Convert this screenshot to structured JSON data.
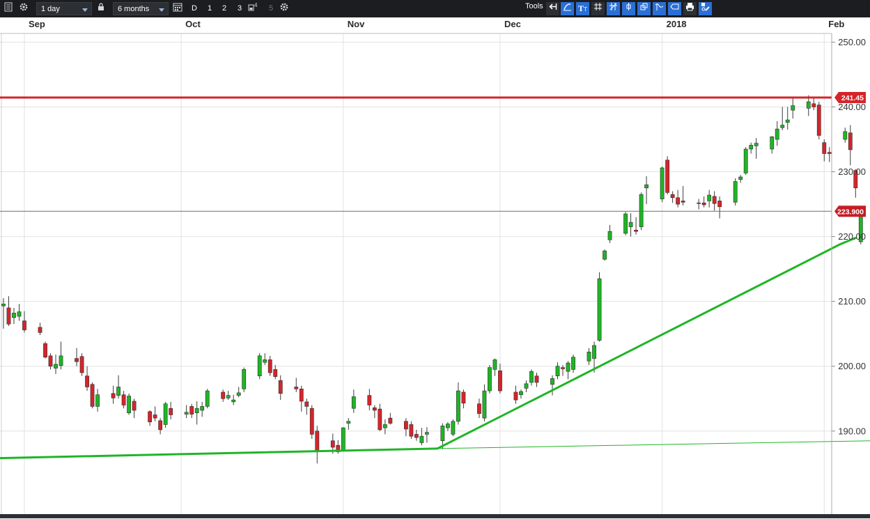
{
  "toolbar": {
    "interval": "1 day",
    "range": "6 months",
    "d_label": "D",
    "btn1": "1",
    "btn2": "2",
    "btn3": "3",
    "btn4_sup": "4",
    "btn5": "5",
    "tools_label": "Tools"
  },
  "colors": {
    "up": "#1fb526",
    "down": "#d4252b",
    "resistance": "#d4252b",
    "trend": "#1fb526",
    "grid": "#e2e2e2",
    "toolbar": "#1b1d20"
  },
  "chart_data": {
    "type": "candlestick",
    "title": "",
    "xlabel": "",
    "ylabel": "",
    "x_ticks": [
      {
        "label": "Sep",
        "day": 0
      },
      {
        "label": "Oct",
        "day": 30
      },
      {
        "label": "Nov",
        "day": 61
      },
      {
        "label": "Dec",
        "day": 91
      },
      {
        "label": "2018",
        "day": 122
      },
      {
        "label": "Feb",
        "day": 153
      }
    ],
    "y_ticks": [
      190,
      200,
      210,
      220,
      230,
      240,
      250
    ],
    "y_tick_labels": [
      "190.00",
      "200.00",
      "210.00",
      "220.00",
      "230.00",
      "240.00",
      "250.00"
    ],
    "ylim": [
      178,
      253
    ],
    "grid": true,
    "resistance": {
      "value": 241.45,
      "label": "241.45"
    },
    "last_price": {
      "value": 223.9,
      "label": "223.900"
    },
    "trendlines": [
      {
        "id": "lower-trendline",
        "points": [
          [
            "2017-08-26",
            185.8
          ],
          [
            "2017-11-19",
            187.3
          ]
        ],
        "width": 3
      },
      {
        "id": "upper-trendline",
        "points": [
          [
            "2017-11-19",
            187.3
          ],
          [
            "2018-02-04",
            218.8
          ],
          [
            "2018-02-07",
            219.8
          ]
        ],
        "width": 3
      },
      {
        "id": "extension-line",
        "points": [
          [
            "2017-11-19",
            187.3
          ],
          [
            "2018-02-10",
            188.5
          ]
        ],
        "width": 1
      }
    ],
    "ohlc": [
      [
        "2017-08-28",
        209.3,
        210.5,
        205.8,
        209.6
      ],
      [
        "2017-08-29",
        209.0,
        210.8,
        206.2,
        206.5
      ],
      [
        "2017-08-30",
        207.5,
        209.0,
        206.5,
        208.2
      ],
      [
        "2017-08-31",
        207.7,
        209.6,
        207.0,
        208.4
      ],
      [
        "2017-09-01",
        207.0,
        208.5,
        205.2,
        205.6
      ],
      [
        "2017-09-04",
        206.0,
        206.7,
        204.8,
        205.2
      ],
      [
        "2017-09-05",
        203.5,
        203.8,
        201.2,
        201.4
      ],
      [
        "2017-09-06",
        201.6,
        202.0,
        199.5,
        200.0
      ],
      [
        "2017-09-07",
        199.7,
        201.8,
        198.8,
        200.3
      ],
      [
        "2017-09-08",
        200.1,
        203.8,
        199.5,
        201.6
      ],
      [
        "2017-09-11",
        201.2,
        202.8,
        200.0,
        200.7
      ],
      [
        "2017-09-12",
        201.5,
        202.0,
        198.5,
        199.0
      ],
      [
        "2017-09-13",
        198.5,
        200.0,
        196.2,
        196.8
      ],
      [
        "2017-09-14",
        197.2,
        197.5,
        193.5,
        193.8
      ],
      [
        "2017-09-15",
        193.8,
        196.5,
        193.0,
        195.6
      ],
      [
        "2017-09-18",
        195.8,
        197.0,
        194.2,
        195.1
      ],
      [
        "2017-09-19",
        195.5,
        198.6,
        195.0,
        196.8
      ],
      [
        "2017-09-20",
        195.6,
        196.2,
        193.5,
        194.0
      ],
      [
        "2017-09-21",
        192.8,
        195.8,
        192.5,
        195.4
      ],
      [
        "2017-09-22",
        194.6,
        195.0,
        192.0,
        193.2
      ],
      [
        "2017-09-25",
        193.0,
        193.2,
        190.8,
        191.4
      ],
      [
        "2017-09-26",
        192.5,
        193.8,
        191.5,
        192.0
      ],
      [
        "2017-09-27",
        191.6,
        192.0,
        189.5,
        190.2
      ],
      [
        "2017-09-28",
        191.0,
        194.5,
        190.5,
        194.2
      ],
      [
        "2017-09-29",
        193.5,
        194.5,
        191.8,
        192.5
      ],
      [
        "2017-10-02",
        192.6,
        194.0,
        192.0,
        192.9
      ],
      [
        "2017-10-03",
        193.8,
        194.2,
        192.0,
        192.6
      ],
      [
        "2017-10-04",
        192.8,
        194.6,
        191.0,
        193.5
      ],
      [
        "2017-10-05",
        193.2,
        194.5,
        192.2,
        193.8
      ],
      [
        "2017-10-06",
        193.8,
        196.5,
        193.5,
        196.2
      ],
      [
        "2017-10-09",
        196.0,
        196.4,
        194.5,
        195.0
      ],
      [
        "2017-10-10",
        195.1,
        196.2,
        194.8,
        195.5
      ],
      [
        "2017-10-11",
        194.5,
        195.6,
        194.0,
        194.8
      ],
      [
        "2017-10-12",
        195.5,
        196.8,
        195.2,
        195.9
      ],
      [
        "2017-10-13",
        196.5,
        199.8,
        196.0,
        199.5
      ],
      [
        "2017-10-16",
        198.5,
        202.0,
        198.0,
        201.6
      ],
      [
        "2017-10-17",
        200.6,
        202.0,
        200.2,
        201.0
      ],
      [
        "2017-10-18",
        201.0,
        201.6,
        198.5,
        199.0
      ],
      [
        "2017-10-19",
        199.5,
        200.2,
        198.0,
        198.4
      ],
      [
        "2017-10-20",
        197.8,
        198.6,
        194.8,
        195.8
      ],
      [
        "2017-10-23",
        196.8,
        198.2,
        196.0,
        196.5
      ],
      [
        "2017-10-24",
        196.5,
        197.0,
        193.0,
        194.6
      ],
      [
        "2017-10-25",
        194.5,
        195.0,
        192.5,
        193.8
      ],
      [
        "2017-10-26",
        193.5,
        194.0,
        188.8,
        189.5
      ],
      [
        "2017-10-27",
        190.0,
        190.8,
        185.0,
        186.8
      ],
      [
        "2017-10-30",
        188.5,
        189.6,
        186.5,
        187.5
      ],
      [
        "2017-10-31",
        187.8,
        188.6,
        186.5,
        186.8
      ],
      [
        "2017-11-01",
        187.0,
        190.6,
        186.8,
        190.5
      ],
      [
        "2017-11-02",
        191.2,
        192.0,
        190.2,
        191.5
      ],
      [
        "2017-11-03",
        193.5,
        196.4,
        192.8,
        195.3
      ],
      [
        "2017-11-06",
        195.5,
        196.5,
        193.2,
        194.0
      ],
      [
        "2017-11-07",
        193.6,
        194.0,
        192.0,
        193.2
      ],
      [
        "2017-11-08",
        193.4,
        194.2,
        190.0,
        190.2
      ],
      [
        "2017-11-09",
        190.5,
        191.8,
        189.5,
        191.0
      ],
      [
        "2017-11-10",
        192.0,
        192.8,
        191.0,
        191.2
      ],
      [
        "2017-11-13",
        191.5,
        192.0,
        189.2,
        190.3
      ],
      [
        "2017-11-14",
        191.0,
        191.5,
        188.8,
        189.2
      ],
      [
        "2017-11-15",
        189.5,
        190.2,
        188.5,
        189.0
      ],
      [
        "2017-11-16",
        188.2,
        190.5,
        187.8,
        189.2
      ],
      [
        "2017-11-17",
        189.5,
        190.6,
        188.2,
        189.8
      ],
      [
        "2017-11-20",
        188.5,
        191.2,
        187.2,
        190.8
      ],
      [
        "2017-11-21",
        190.5,
        191.4,
        190.0,
        191.1
      ],
      [
        "2017-11-22",
        189.5,
        191.8,
        189.2,
        191.5
      ],
      [
        "2017-11-23",
        191.5,
        197.5,
        191.0,
        196.2
      ],
      [
        "2017-11-24",
        196.0,
        196.4,
        193.5,
        194.3
      ],
      [
        "2017-11-27",
        194.2,
        195.0,
        192.0,
        192.7
      ],
      [
        "2017-11-28",
        192.0,
        197.2,
        191.5,
        196.2
      ],
      [
        "2017-11-29",
        196.2,
        200.2,
        195.8,
        199.8
      ],
      [
        "2017-11-30",
        199.5,
        201.2,
        198.5,
        201.0
      ],
      [
        "2017-12-01",
        199.3,
        200.4,
        195.8,
        196.2
      ],
      [
        "2017-12-04",
        196.0,
        197.0,
        194.2,
        194.8
      ],
      [
        "2017-12-05",
        195.6,
        196.4,
        195.0,
        196.1
      ],
      [
        "2017-12-06",
        196.6,
        197.8,
        196.0,
        197.3
      ],
      [
        "2017-12-07",
        197.5,
        199.5,
        197.0,
        199.2
      ],
      [
        "2017-12-08",
        198.5,
        199.0,
        196.8,
        197.5
      ],
      [
        "2017-12-11",
        197.2,
        198.6,
        195.5,
        198.1
      ],
      [
        "2017-12-12",
        198.5,
        200.6,
        198.0,
        200.0
      ],
      [
        "2017-12-13",
        199.8,
        200.2,
        198.5,
        199.6
      ],
      [
        "2017-12-14",
        199.2,
        200.8,
        198.0,
        200.5
      ],
      [
        "2017-12-15",
        199.5,
        201.8,
        199.0,
        201.4
      ],
      [
        "2017-12-18",
        200.8,
        202.8,
        200.2,
        202.2
      ],
      [
        "2017-12-19",
        201.2,
        203.8,
        199.0,
        203.2
      ],
      [
        "2017-12-20",
        204.0,
        214.5,
        203.8,
        213.5
      ],
      [
        "2017-12-21",
        216.5,
        218.0,
        216.3,
        217.8
      ],
      [
        "2017-12-22",
        219.5,
        221.8,
        219.0,
        220.8
      ],
      [
        "2017-12-25",
        220.5,
        223.8,
        220.2,
        223.5
      ],
      [
        "2017-12-26",
        221.5,
        223.6,
        220.0,
        222.2
      ],
      [
        "2017-12-27",
        221.0,
        223.0,
        220.3,
        220.8
      ],
      [
        "2017-12-28",
        221.5,
        226.8,
        221.0,
        226.5
      ],
      [
        "2017-12-29",
        227.5,
        229.3,
        225.0,
        228.0
      ],
      [
        "2018-01-01",
        225.8,
        230.8,
        225.3,
        230.6
      ],
      [
        "2018-01-02",
        231.8,
        232.4,
        226.5,
        226.8
      ],
      [
        "2018-01-03",
        226.5,
        227.0,
        225.2,
        226.0
      ],
      [
        "2018-01-04",
        226.0,
        227.2,
        224.5,
        225.0
      ],
      [
        "2018-01-05",
        225.5,
        227.8,
        224.8,
        225.3
      ],
      [
        "2018-01-08",
        225.2,
        225.8,
        224.2,
        225.1
      ],
      [
        "2018-01-09",
        225.2,
        226.2,
        224.5,
        224.9
      ],
      [
        "2018-01-10",
        225.5,
        227.2,
        224.5,
        226.4
      ],
      [
        "2018-01-11",
        226.2,
        227.0,
        224.0,
        225.1
      ],
      [
        "2018-01-12",
        225.5,
        226.2,
        222.8,
        224.6
      ],
      [
        "2018-01-15",
        225.3,
        229.0,
        224.8,
        228.5
      ],
      [
        "2018-01-16",
        228.8,
        229.5,
        228.3,
        229.2
      ],
      [
        "2018-01-17",
        229.8,
        233.8,
        229.5,
        233.5
      ],
      [
        "2018-01-18",
        233.5,
        234.5,
        232.8,
        234.1
      ],
      [
        "2018-01-19",
        234.0,
        235.2,
        232.0,
        234.4
      ],
      [
        "2018-01-22",
        233.5,
        235.5,
        232.8,
        235.4
      ],
      [
        "2018-01-23",
        235.0,
        237.8,
        234.0,
        236.6
      ],
      [
        "2018-01-24",
        236.8,
        240.0,
        236.4,
        237.2
      ],
      [
        "2018-01-25",
        237.6,
        240.0,
        236.5,
        238.0
      ],
      [
        "2018-01-26",
        239.5,
        241.6,
        238.2,
        240.2
      ],
      [
        "2018-01-29",
        239.8,
        241.8,
        238.6,
        240.8
      ],
      [
        "2018-01-30",
        240.5,
        241.5,
        239.5,
        240.0
      ],
      [
        "2018-01-31",
        240.3,
        240.8,
        235.0,
        235.6
      ],
      [
        "2018-02-01",
        234.5,
        235.0,
        231.6,
        232.8
      ],
      [
        "2018-02-02",
        233.0,
        233.8,
        231.5,
        232.8
      ],
      [
        "2018-02-05",
        235.0,
        236.8,
        234.5,
        236.2
      ],
      [
        "2018-02-06",
        236.0,
        237.2,
        231.0,
        233.4
      ],
      [
        "2018-02-07",
        230.2,
        230.4,
        226.0,
        227.5
      ],
      [
        "2018-02-08",
        219.2,
        224.2,
        218.8,
        223.9
      ]
    ]
  }
}
